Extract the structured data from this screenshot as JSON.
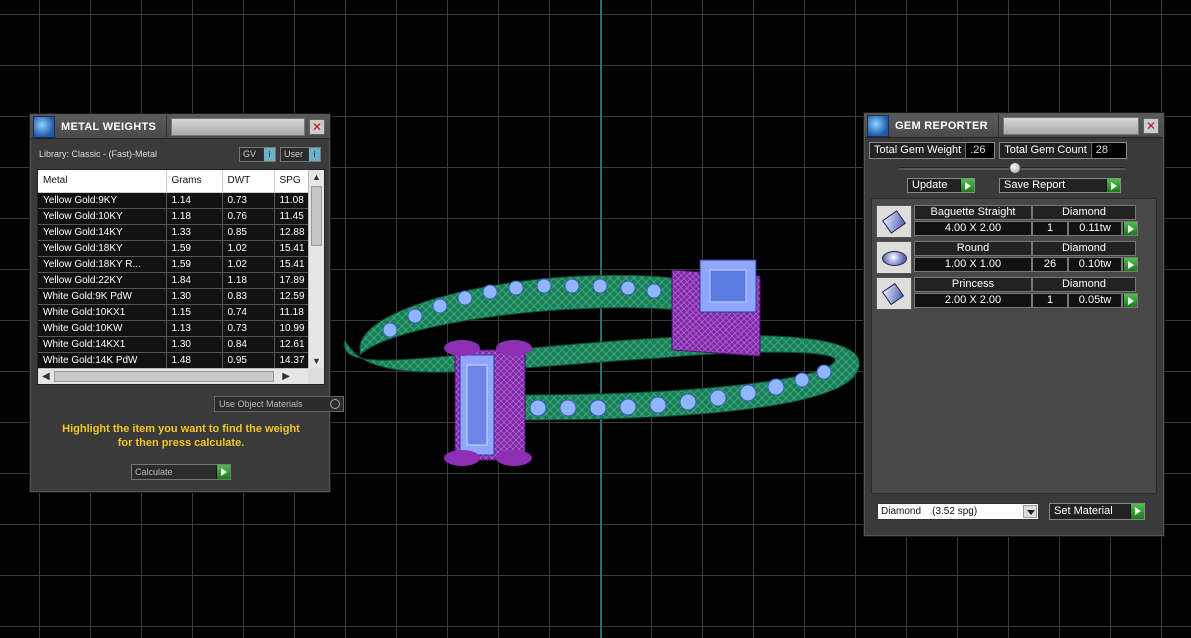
{
  "metal_weights": {
    "title": "METAL WEIGHTS",
    "library_label": "Library: Classic - (Fast)-Metal",
    "gv_label": "GV",
    "user_label": "User",
    "columns": [
      "Metal",
      "Grams",
      "DWT",
      "SPG"
    ],
    "rows": [
      [
        "Yellow Gold:9KY",
        "1.14",
        "0.73",
        "11.08"
      ],
      [
        "Yellow Gold:10KY",
        "1.18",
        "0.76",
        "11.45"
      ],
      [
        "Yellow Gold:14KY",
        "1.33",
        "0.85",
        "12.88"
      ],
      [
        "Yellow Gold:18KY",
        "1.59",
        "1.02",
        "15.41"
      ],
      [
        "Yellow Gold:18KY R...",
        "1.59",
        "1.02",
        "15.41"
      ],
      [
        "Yellow Gold:22KY",
        "1.84",
        "1.18",
        "17.89"
      ],
      [
        "White Gold:9K PdW",
        "1.30",
        "0.83",
        "12.59"
      ],
      [
        "White Gold:10KX1",
        "1.15",
        "0.74",
        "11.18"
      ],
      [
        "White Gold:10KW",
        "1.13",
        "0.73",
        "10.99"
      ],
      [
        "White Gold:14KX1",
        "1.30",
        "0.84",
        "12.61"
      ],
      [
        "White Gold:14K PdW",
        "1.48",
        "0.95",
        "14.37"
      ]
    ],
    "use_object_materials": "Use Object Materials",
    "hint_line1": "Highlight the item you want to find the weight",
    "hint_line2": "for then press calculate.",
    "calculate_label": "Calculate"
  },
  "gem_reporter": {
    "title": "GEM REPORTER",
    "total_weight_label": "Total Gem Weight",
    "total_weight_value": ".26",
    "total_count_label": "Total Gem Count",
    "total_count_value": "28",
    "update_label": "Update",
    "save_report_label": "Save Report",
    "gems": [
      {
        "shape": "Baguette Straight",
        "material": "Diamond",
        "size": "4.00 X 2.00",
        "qty": "1",
        "weight": "0.11tw"
      },
      {
        "shape": "Round",
        "material": "Diamond",
        "size": "1.00 X 1.00",
        "qty": "26",
        "weight": "0.10tw"
      },
      {
        "shape": "Princess",
        "material": "Diamond",
        "size": "2.00 X 2.00",
        "qty": "1",
        "weight": "0.05tw"
      }
    ],
    "material_select": "Diamond    (3.52 spg)",
    "set_material_label": "Set Material"
  },
  "colors": {
    "hint_text": "#f2c623",
    "band": "#1e8a60",
    "stones": "#8fb6ff",
    "head": "#8d2fb5"
  }
}
